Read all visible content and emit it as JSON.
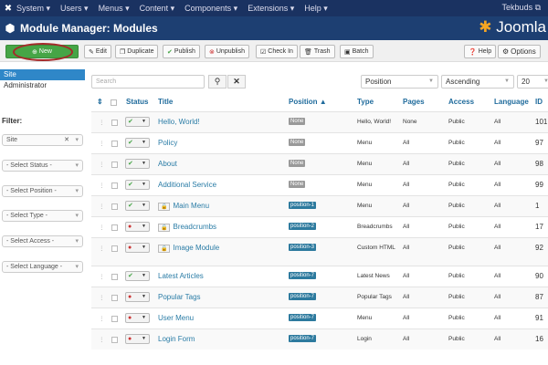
{
  "topnav": {
    "items": [
      "System ▾",
      "Users ▾",
      "Menus ▾",
      "Content ▾",
      "Components ▾",
      "Extensions ▾",
      "Help ▾"
    ],
    "user": "Tekbuds ⧉"
  },
  "title": "Module Manager: Modules",
  "brand": "Joomla",
  "toolbar": {
    "new": "New",
    "edit": "Edit",
    "duplicate": "Duplicate",
    "publish": "Publish",
    "unpublish": "Unpublish",
    "checkin": "Check In",
    "trash": "Trash",
    "batch": "Batch",
    "help": "Help",
    "options": "Options"
  },
  "sidebar": {
    "items": [
      "Site",
      "Administrator"
    ],
    "filter_label": "Filter:",
    "filters": [
      "Site",
      "- Select Status -",
      "- Select Position -",
      "- Select Type -",
      "- Select Access -",
      "- Select Language -"
    ]
  },
  "search": {
    "placeholder": "Search"
  },
  "sort": {
    "field": "Position",
    "order": "Ascending",
    "limit": "20"
  },
  "columns": {
    "status": "Status",
    "title": "Title",
    "position": "Position ▲",
    "type": "Type",
    "pages": "Pages",
    "access": "Access",
    "language": "Language",
    "id": "ID"
  },
  "colors": {
    "none_badge": "#999999",
    "position_badge": "#2d7a9e",
    "published": "#46a546",
    "unpublished": "#cc3333"
  },
  "rows": [
    {
      "title": "Hello, World!",
      "locked": false,
      "published": true,
      "position": "None",
      "type": "Hello, World!",
      "pages": "None",
      "access": "Public",
      "language": "All",
      "id": "101"
    },
    {
      "title": "Policy",
      "locked": false,
      "published": true,
      "position": "None",
      "type": "Menu",
      "pages": "All",
      "access": "Public",
      "language": "All",
      "id": "97"
    },
    {
      "title": "About",
      "locked": false,
      "published": true,
      "position": "None",
      "type": "Menu",
      "pages": "All",
      "access": "Public",
      "language": "All",
      "id": "98"
    },
    {
      "title": "Additional Service",
      "locked": false,
      "published": true,
      "position": "None",
      "type": "Menu",
      "pages": "All",
      "access": "Public",
      "language": "All",
      "id": "99"
    },
    {
      "title": "Main Menu",
      "locked": true,
      "published": true,
      "position": "position-1",
      "type": "Menu",
      "pages": "All",
      "access": "Public",
      "language": "All",
      "id": "1"
    },
    {
      "title": "Breadcrumbs",
      "locked": true,
      "published": false,
      "position": "position-2",
      "type": "Breadcrumbs",
      "pages": "All",
      "access": "Public",
      "language": "All",
      "id": "17"
    },
    {
      "title": "Image Module",
      "locked": true,
      "published": false,
      "position": "position-3",
      "type": "Custom HTML",
      "pages": "All",
      "access": "Public",
      "language": "All",
      "id": "92"
    },
    {
      "title": "Latest Articles",
      "locked": false,
      "published": true,
      "position": "position-7",
      "type": "Latest News",
      "pages": "All",
      "access": "Public",
      "language": "All",
      "id": "90"
    },
    {
      "title": "Popular Tags",
      "locked": false,
      "published": false,
      "position": "position-7",
      "type": "Popular Tags",
      "pages": "All",
      "access": "Public",
      "language": "All",
      "id": "87"
    },
    {
      "title": "User Menu",
      "locked": false,
      "published": false,
      "position": "position-7",
      "type": "Menu",
      "pages": "All",
      "access": "Public",
      "language": "All",
      "id": "91"
    },
    {
      "title": "Login Form",
      "locked": false,
      "published": false,
      "position": "position-7",
      "type": "Login",
      "pages": "All",
      "access": "Public",
      "language": "All",
      "id": "16"
    }
  ]
}
